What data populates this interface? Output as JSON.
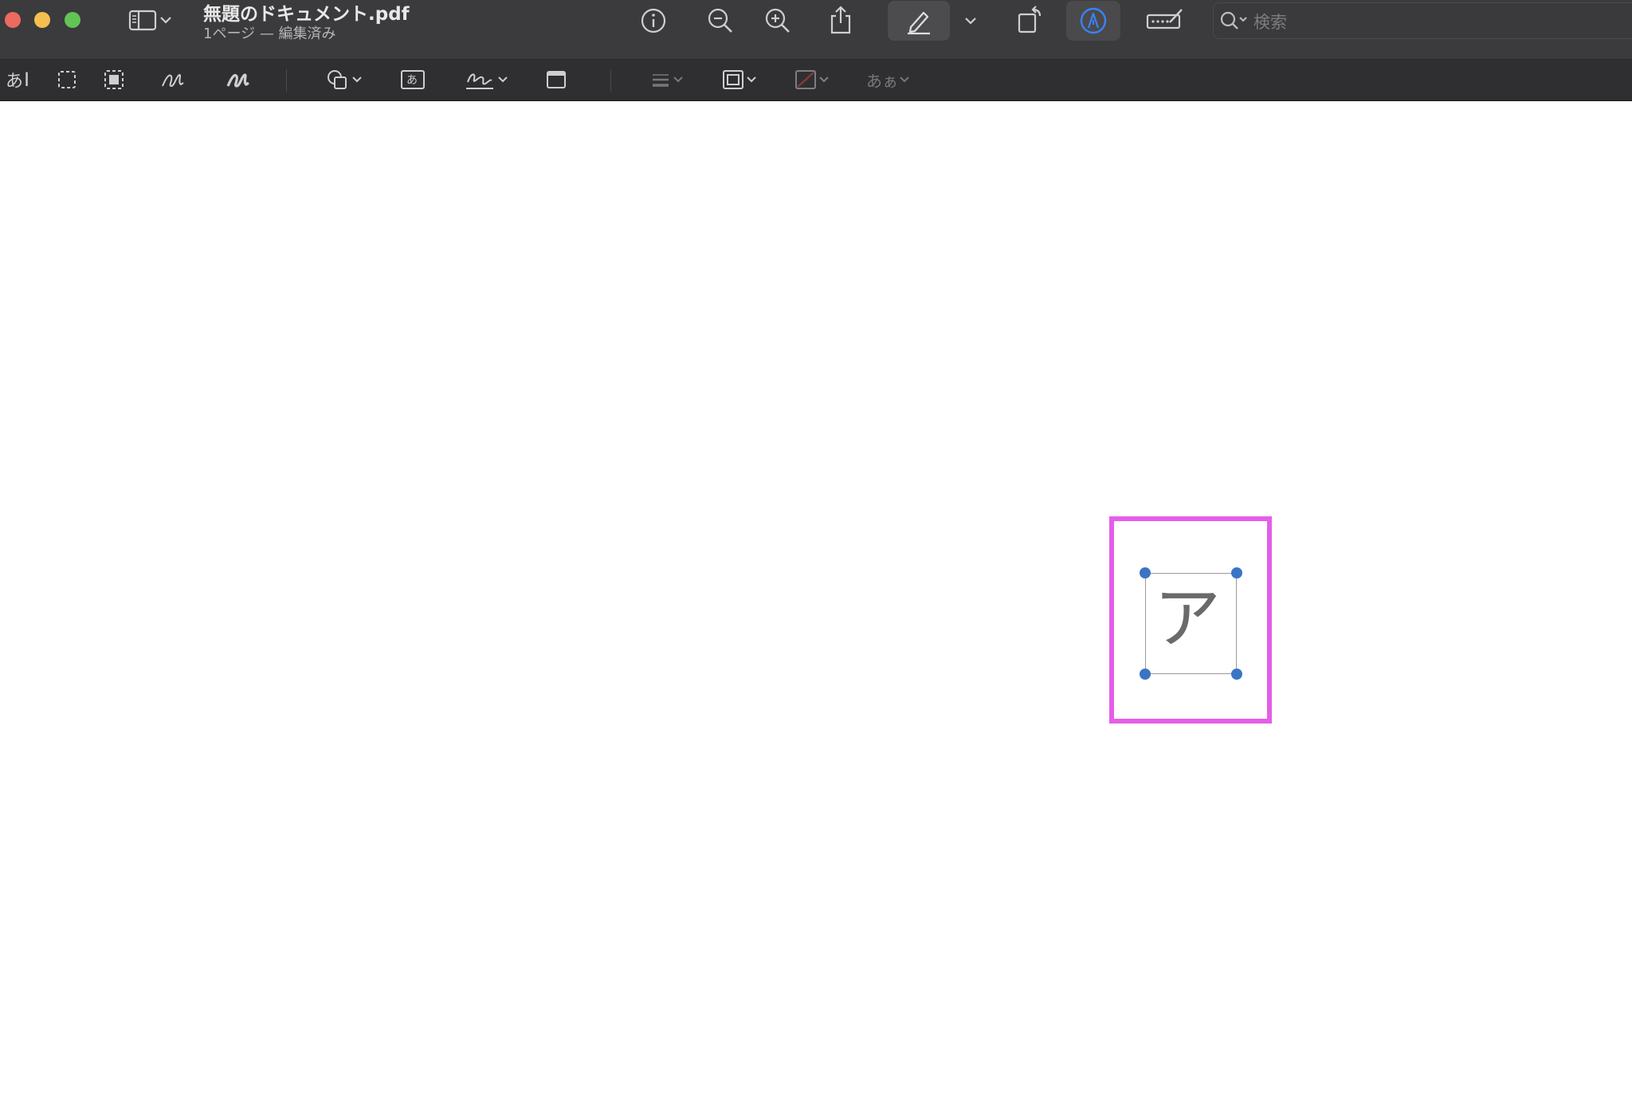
{
  "window": {
    "title": "無題のドキュメント.pdf",
    "subtitle": "1ページ — 編集済み"
  },
  "search": {
    "placeholder": "検索"
  },
  "toolbar_markup": {
    "text_selection_label": "あ",
    "text_box_label": "あ",
    "font_style_label": "あぁ"
  },
  "signature_box": {
    "glyph": "ア"
  },
  "colors": {
    "titlebar": "#3b3b3d",
    "toolbar": "#2f2f31",
    "close": "#ed6a5e",
    "minimize": "#f5bf4f",
    "zoom": "#61c554",
    "accent_blue": "#3a82f7",
    "highlight_box": "#e45ee8",
    "handle": "#3b74c6"
  },
  "icons": [
    "sidebar-icon",
    "chevron-down-icon",
    "info-icon",
    "zoom-out-icon",
    "zoom-in-icon",
    "share-icon",
    "highlight-pen-icon",
    "rotate-icon",
    "markup-icon",
    "form-fill-icon",
    "search-icon",
    "rect-select-icon",
    "smart-lasso-icon",
    "sketch-icon",
    "draw-icon",
    "shapes-icon",
    "text-box-icon",
    "signature-icon",
    "note-icon",
    "line-style-icon",
    "border-color-icon",
    "fill-color-icon"
  ]
}
